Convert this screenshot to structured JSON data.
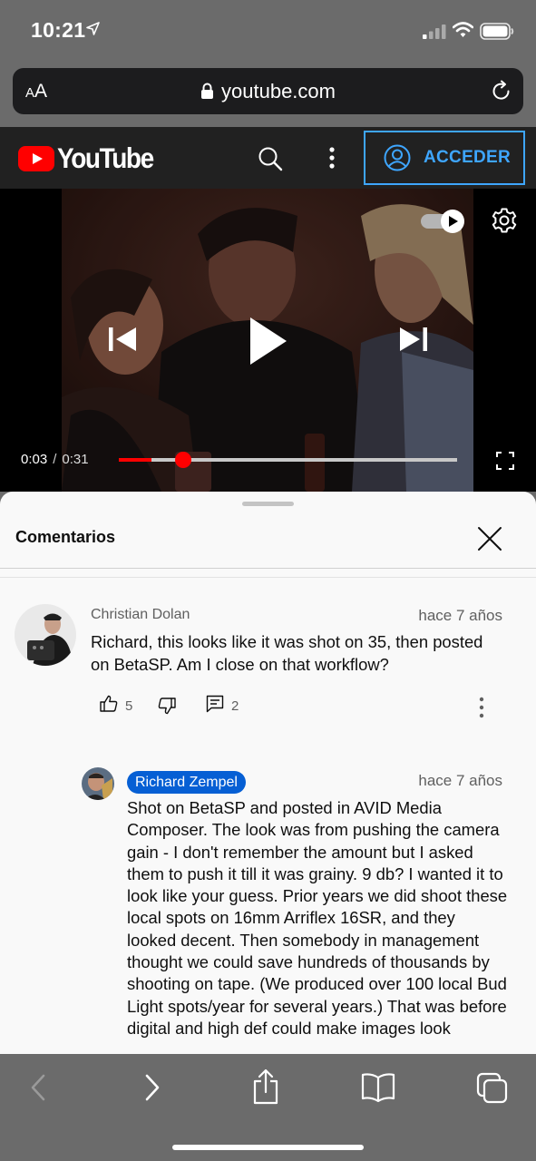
{
  "status_bar": {
    "time": "10:21",
    "icons": [
      "location-arrow-icon",
      "cellular-signal-icon",
      "wifi-icon",
      "battery-icon"
    ]
  },
  "url_bar": {
    "text_size_label_small": "A",
    "text_size_label_large": "A",
    "domain": "youtube.com",
    "secure": true
  },
  "yt_header": {
    "logo_text": "YouTube",
    "signin_label": "ACCEDER",
    "accent_color": "#3ea6ff",
    "brand_color": "#ff0000"
  },
  "player": {
    "current_time": "0:03",
    "separator": "/",
    "duration": "0:31",
    "progress_fraction": 0.097,
    "autoplay_on": true
  },
  "comments": {
    "title": "Comentarios",
    "items": [
      {
        "author": "Christian Dolan",
        "time": "hace 7 años",
        "text": "Richard, this looks like it was shot on 35, then posted on BetaSP. Am I close on that workflow?",
        "likes": "5",
        "replies": "2"
      },
      {
        "author": "Richard Zempel",
        "author_badge_color": "#065fd4",
        "time": "hace 7 años",
        "text": "Shot on BetaSP and posted in AVID Media Composer. The look was from pushing the camera gain - I don't remember the amount but I asked them to push it till it was grainy. 9 db? I wanted it to look like your guess. Prior years we did shoot these local spots on 16mm Arriflex 16SR, and they looked decent. Then somebody in management thought we could save hundreds of thousands by shooting on tape. (We produced over 100 local Bud Light spots/year for several years.) That was before digital and high def could make images look"
      }
    ]
  },
  "toolbar": {
    "buttons": [
      "back-icon",
      "forward-icon",
      "share-icon",
      "bookmarks-icon",
      "tabs-icon"
    ]
  }
}
